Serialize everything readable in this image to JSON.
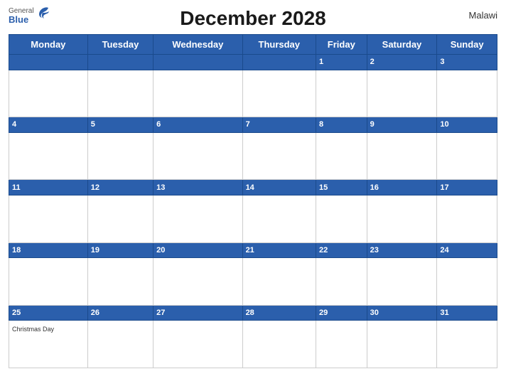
{
  "header": {
    "title": "December 2028",
    "country": "Malawi",
    "logo_general": "General",
    "logo_blue": "Blue"
  },
  "days_of_week": [
    "Monday",
    "Tuesday",
    "Wednesday",
    "Thursday",
    "Friday",
    "Saturday",
    "Sunday"
  ],
  "weeks": [
    {
      "dates": [
        "",
        "",
        "",
        "",
        "1",
        "2",
        "3"
      ],
      "events": [
        "",
        "",
        "",
        "",
        "",
        "",
        ""
      ]
    },
    {
      "dates": [
        "4",
        "5",
        "6",
        "7",
        "8",
        "9",
        "10"
      ],
      "events": [
        "",
        "",
        "",
        "",
        "",
        "",
        ""
      ]
    },
    {
      "dates": [
        "11",
        "12",
        "13",
        "14",
        "15",
        "16",
        "17"
      ],
      "events": [
        "",
        "",
        "",
        "",
        "",
        "",
        ""
      ]
    },
    {
      "dates": [
        "18",
        "19",
        "20",
        "21",
        "22",
        "23",
        "24"
      ],
      "events": [
        "",
        "",
        "",
        "",
        "",
        "",
        ""
      ]
    },
    {
      "dates": [
        "25",
        "26",
        "27",
        "28",
        "29",
        "30",
        "31"
      ],
      "events": [
        "Christmas Day",
        "",
        "",
        "",
        "",
        "",
        ""
      ]
    }
  ],
  "colors": {
    "header_bg": "#2b5fac",
    "header_text": "#ffffff",
    "cell_bg": "#ffffff",
    "border": "#cccccc",
    "date_number": "#ffffff",
    "title_color": "#1a1a1a"
  }
}
